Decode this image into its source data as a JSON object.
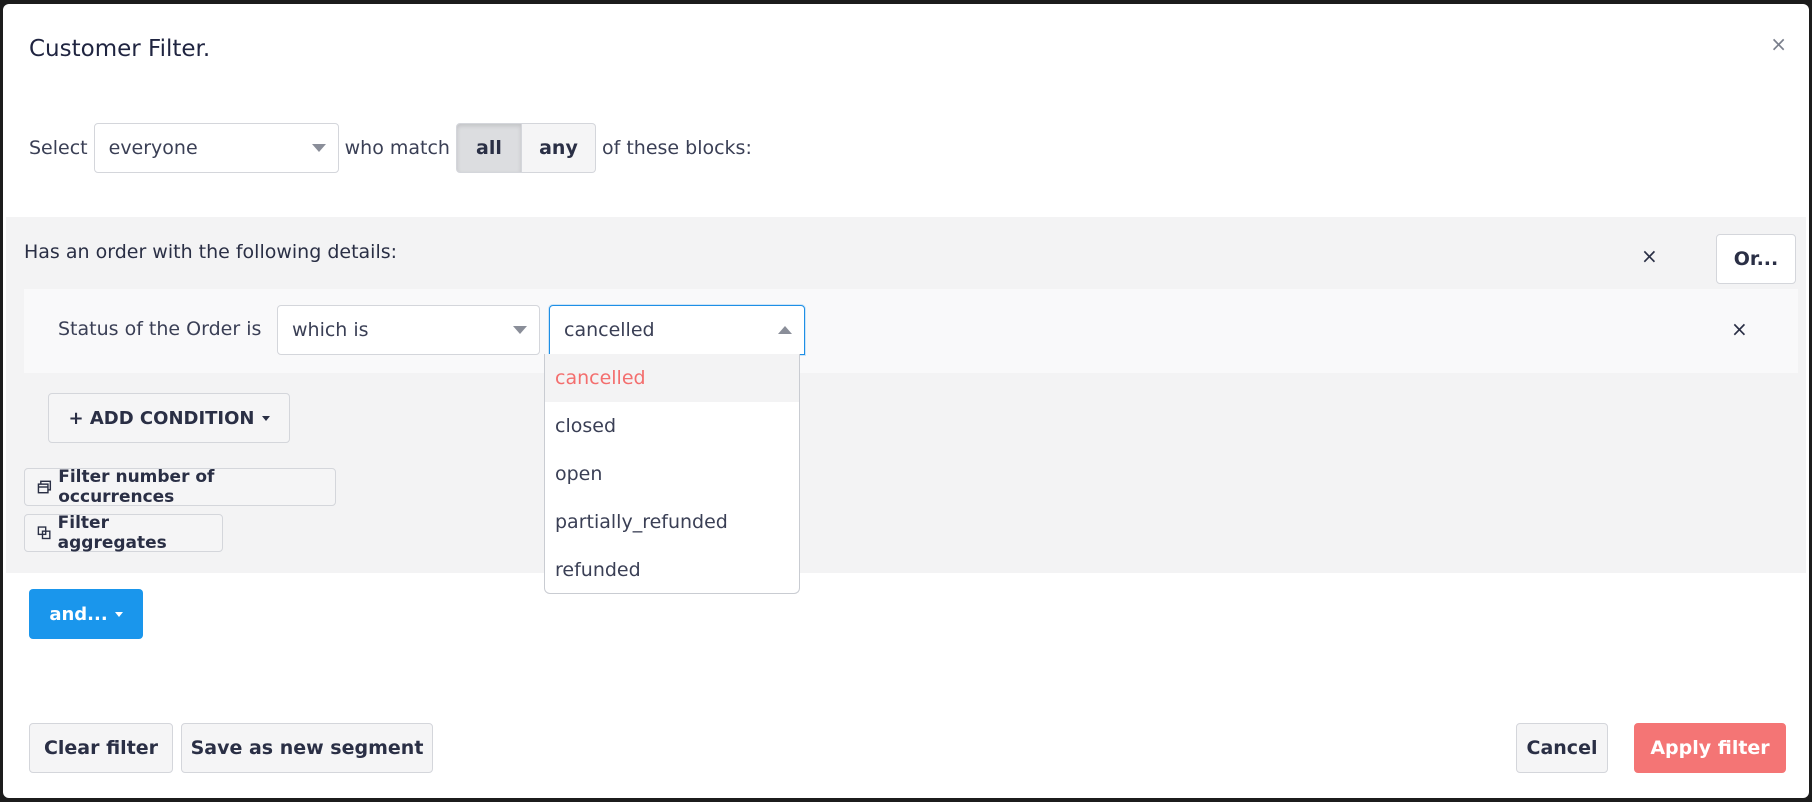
{
  "modal": {
    "title": "Customer Filter.",
    "close_label": "×"
  },
  "selector": {
    "select_label": "Select",
    "audience_value": "everyone",
    "match_label": "who match",
    "match_options": [
      "all",
      "any"
    ],
    "match_selected": "all",
    "suffix_label": "of these blocks:"
  },
  "block": {
    "title": "Has an order with the following details:",
    "remove_label": "×",
    "or_label": "Or...",
    "condition": {
      "label": "Status of the Order is",
      "operator_value": "which is",
      "status_value": "cancelled",
      "remove_label": "×"
    },
    "status_options": [
      "cancelled",
      "closed",
      "open",
      "partially_refunded",
      "refunded"
    ],
    "add_condition_label": "+ ADD CONDITION",
    "filter_occurrences_label": "Filter number of occurrences",
    "filter_aggregates_label": "Filter aggregates"
  },
  "and_label": "and...",
  "footer": {
    "clear_label": "Clear filter",
    "save_label": "Save as new segment",
    "cancel_label": "Cancel",
    "apply_label": "Apply filter"
  },
  "colors": {
    "primary_blue": "#1a96ec",
    "apply_red": "#f47575",
    "selected_option_text": "#f36e6e"
  }
}
